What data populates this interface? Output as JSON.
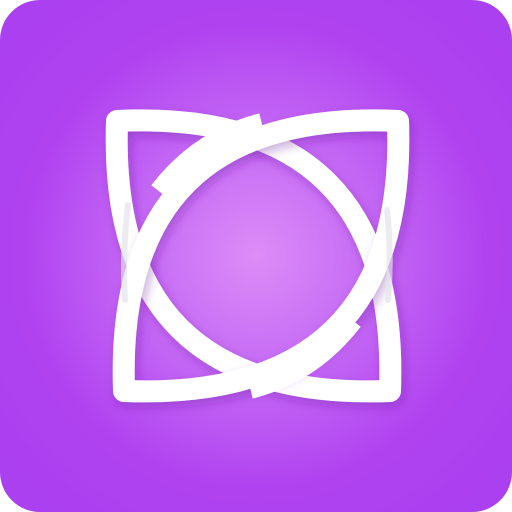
{
  "app_icon": {
    "logo_icon": "interlocked-leaf-loops-logo",
    "colors": {
      "background_center": "#dd8cf7",
      "background_edge": "#a93ff0",
      "logo_stroke": "#ffffff",
      "logo_shadow": "#d9d9de"
    }
  }
}
